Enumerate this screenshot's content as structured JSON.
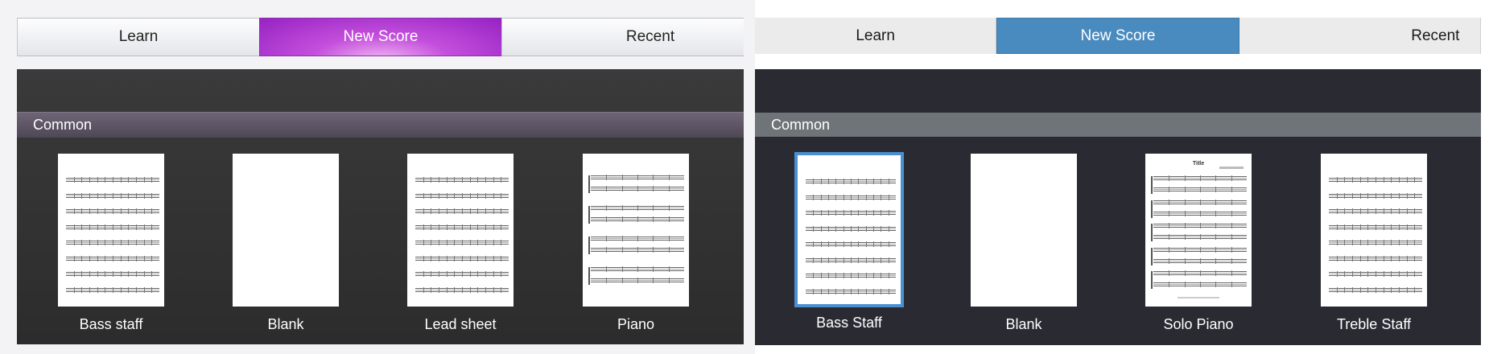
{
  "left": {
    "tabs": [
      {
        "label": "Learn",
        "active": false
      },
      {
        "label": "New Score",
        "active": true
      },
      {
        "label": "Recent",
        "active": false
      }
    ],
    "section_title": "Common",
    "templates": [
      {
        "label": "Bass staff",
        "kind": "staves"
      },
      {
        "label": "Blank",
        "kind": "blank"
      },
      {
        "label": "Lead sheet",
        "kind": "staves"
      },
      {
        "label": "Piano",
        "kind": "piano"
      }
    ],
    "colors": {
      "active_tab": "#9622c3",
      "gallery_bg": "#333333",
      "section_header": "#5e5666"
    }
  },
  "right": {
    "tabs": [
      {
        "label": "Learn",
        "active": false
      },
      {
        "label": "New Score",
        "active": true
      },
      {
        "label": "Recent",
        "active": false
      }
    ],
    "section_title": "Common",
    "templates": [
      {
        "label": "Bass Staff",
        "kind": "staves",
        "selected": true
      },
      {
        "label": "Blank",
        "kind": "blank",
        "selected": false
      },
      {
        "label": "Solo Piano",
        "kind": "solo-piano",
        "selected": false
      },
      {
        "label": "Treble Staff",
        "kind": "staves",
        "selected": false
      }
    ],
    "solo_piano_title": "Title",
    "colors": {
      "active_tab": "#4a8bbf",
      "gallery_bg": "#2a2a33",
      "section_header": "#6f7478",
      "selection": "#4a90d0"
    }
  }
}
